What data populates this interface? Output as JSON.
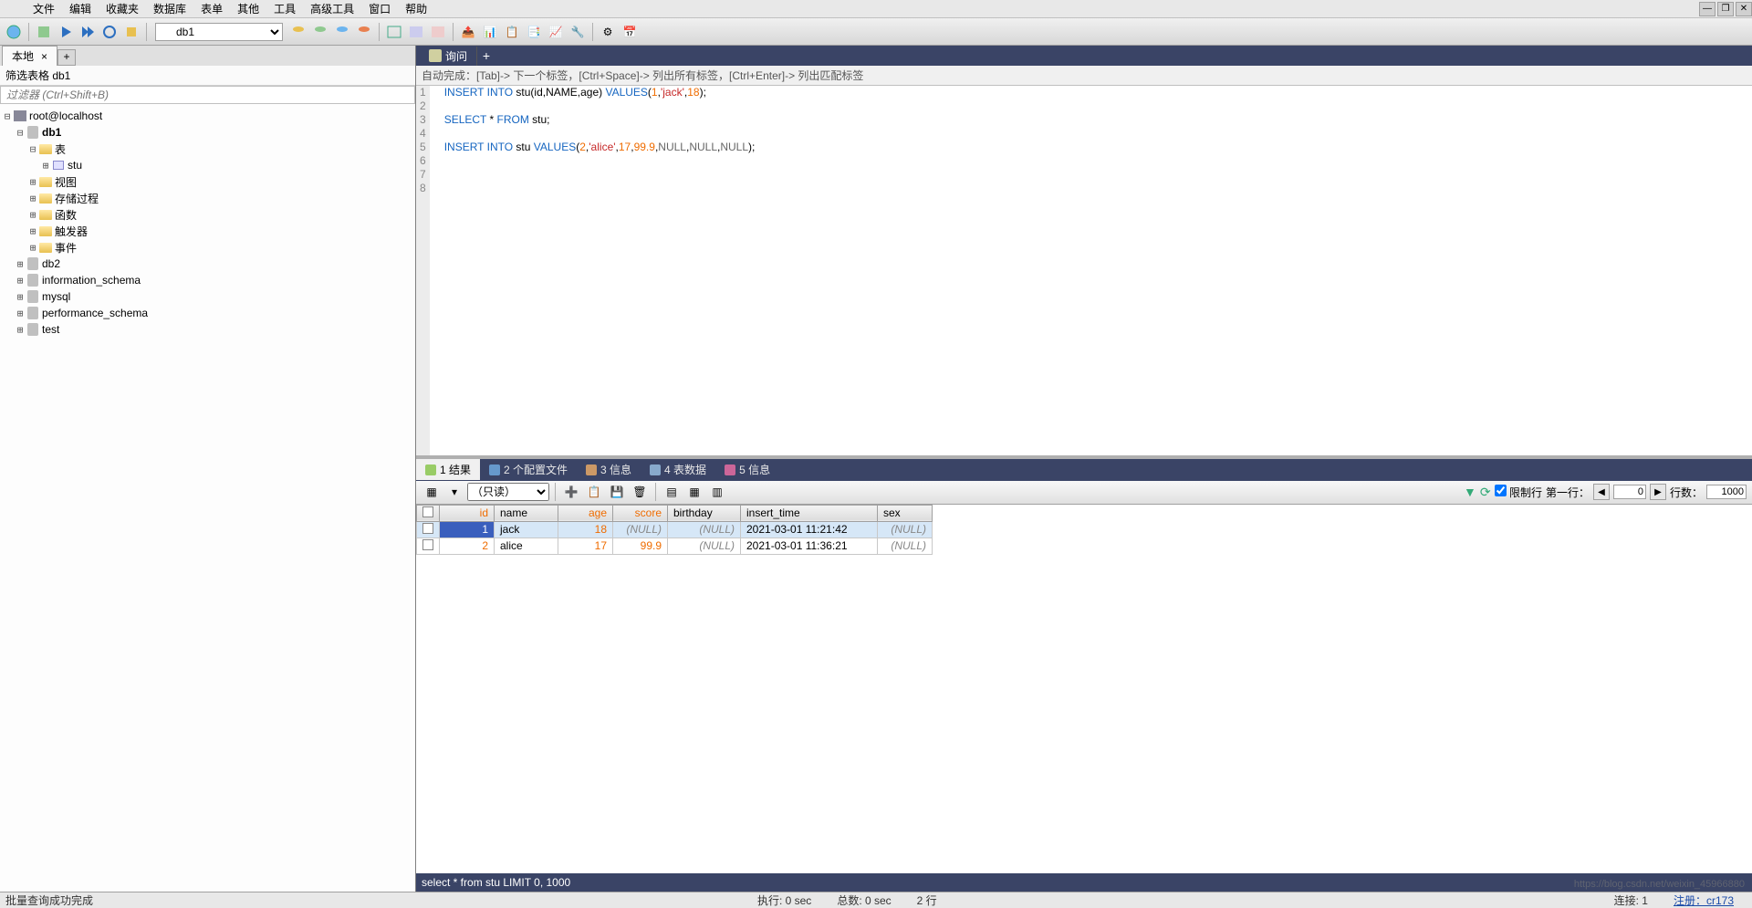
{
  "menubar": [
    "文件",
    "编辑",
    "收藏夹",
    "数据库",
    "表单",
    "其他",
    "工具",
    "高级工具",
    "窗口",
    "帮助"
  ],
  "toolbar_db": "db1",
  "left_tab": "本地",
  "filter_label": "筛选表格 db1",
  "filter_placeholder": "过滤器 (Ctrl+Shift+B)",
  "tree": {
    "server": "root@localhost",
    "db1": {
      "name": "db1",
      "tables": "表",
      "stu": "stu",
      "views": "视图",
      "procs": "存储过程",
      "funcs": "函数",
      "triggers": "触发器",
      "events": "事件"
    },
    "others": [
      "db2",
      "information_schema",
      "mysql",
      "performance_schema",
      "test"
    ]
  },
  "query_tab": "询问",
  "hint": "自动完成：[Tab]-> 下一个标签，[Ctrl+Space]-> 列出所有标签，[Ctrl+Enter]-> 列出匹配标签",
  "code_lines": 8,
  "result_tabs": {
    "t1": "1 结果",
    "t2": "2 个配置文件",
    "t3": "3 信息",
    "t4": "4 表数据",
    "t5": "5 信息"
  },
  "readonly": "（只读）",
  "limit": {
    "label": "限制行",
    "first": "第一行：",
    "first_val": "0",
    "rows": "行数：",
    "rows_val": "1000"
  },
  "columns": [
    "id",
    "name",
    "age",
    "score",
    "birthday",
    "insert_time",
    "sex"
  ],
  "rows": [
    {
      "id": "1",
      "name": "jack",
      "age": "18",
      "score": "(NULL)",
      "birthday": "(NULL)",
      "insert_time": "2021-03-01 11:21:42",
      "sex": "(NULL)"
    },
    {
      "id": "2",
      "name": "alice",
      "age": "17",
      "score": "99.9",
      "birthday": "(NULL)",
      "insert_time": "2021-03-01 11:36:21",
      "sex": "(NULL)"
    }
  ],
  "query_footer": "select * from stu LIMIT 0, 1000",
  "status": {
    "msg": "批量查询成功完成",
    "exec": "执行: 0 sec",
    "total": "总数: 0 sec",
    "rows": "2 行",
    "conn": "连接: 1",
    "reg": "注册：cr173"
  },
  "watermark": "https://blog.csdn.net/weixin_45966880"
}
